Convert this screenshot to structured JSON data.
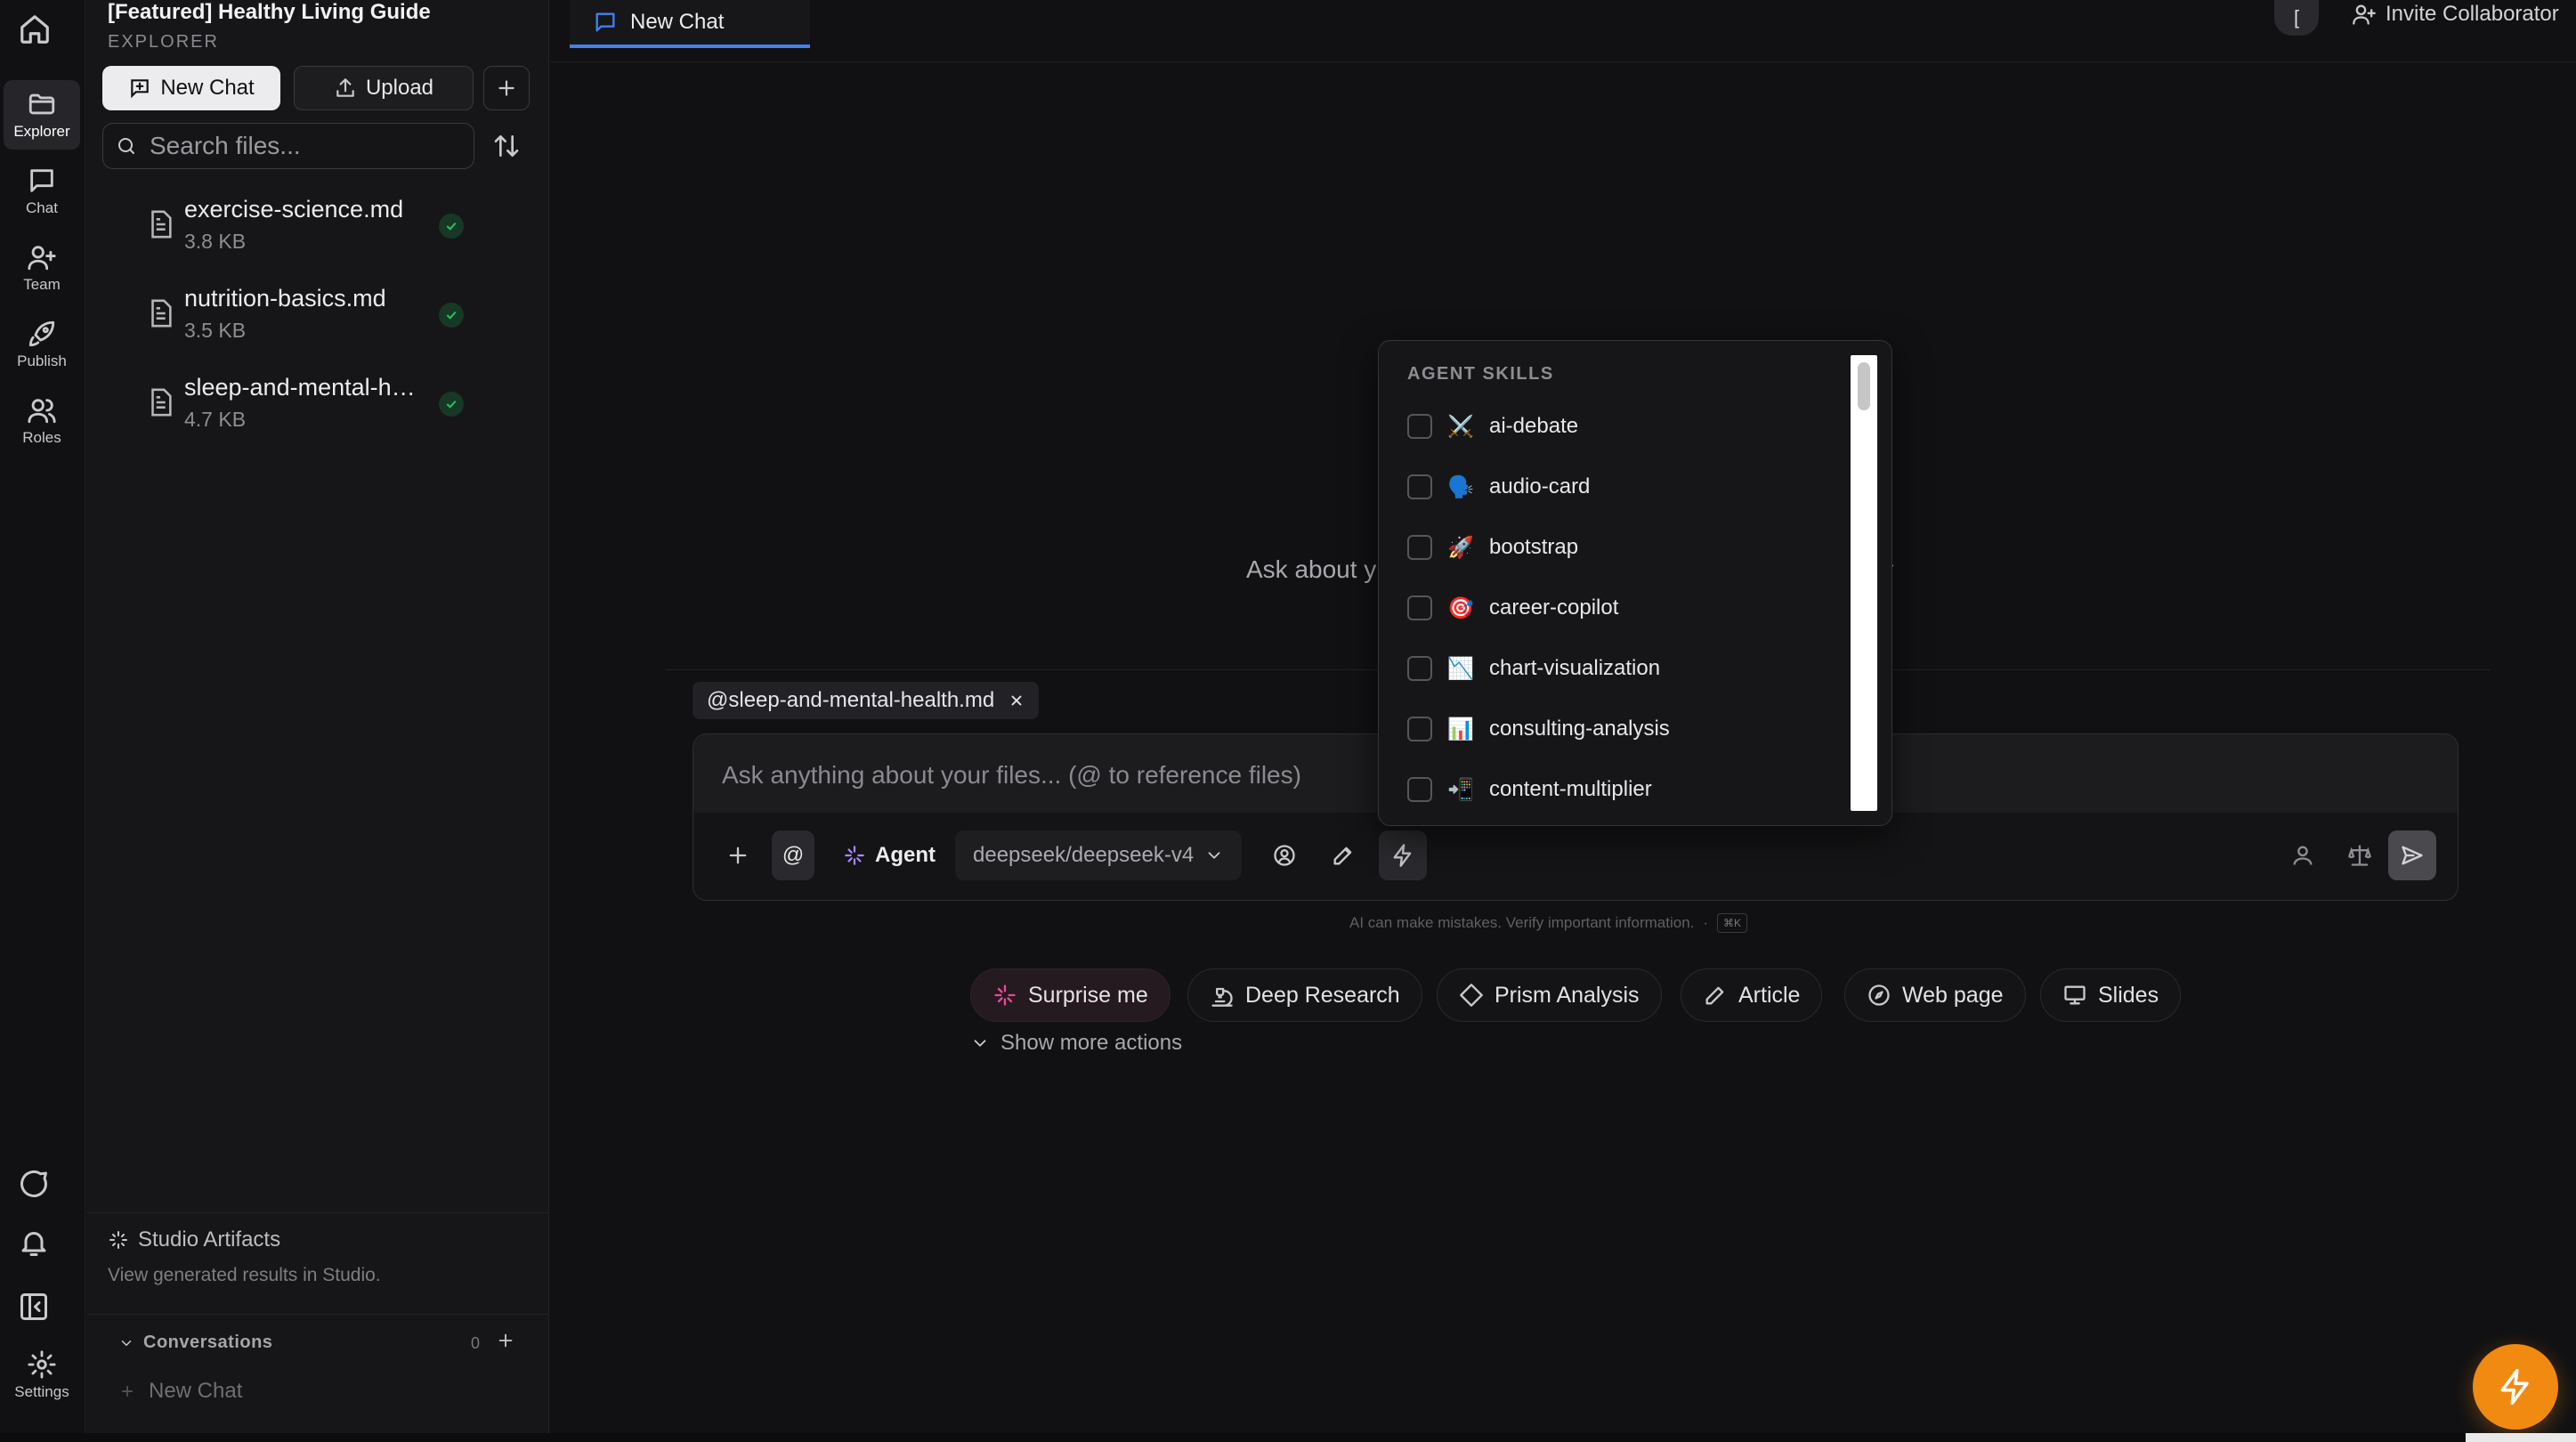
{
  "rail": {
    "items": [
      {
        "label": "Explorer"
      },
      {
        "label": "Chat"
      },
      {
        "label": "Team"
      },
      {
        "label": "Publish"
      },
      {
        "label": "Roles"
      }
    ],
    "settings_label": "Settings"
  },
  "explorer": {
    "project_title": "[Featured] Healthy Living Guide",
    "section_label": "EXPLORER",
    "new_chat_label": "New Chat",
    "upload_label": "Upload",
    "search_placeholder": "Search files...",
    "files": [
      {
        "name": "exercise-science.md",
        "size": "3.8 KB"
      },
      {
        "name": "nutrition-basics.md",
        "size": "3.5 KB"
      },
      {
        "name": "sleep-and-mental-health.md",
        "size": "4.7 KB"
      }
    ],
    "studio_title": "Studio Artifacts",
    "studio_sub": "View generated results in Studio.",
    "conversations_label": "Conversations",
    "conversations_count": "0",
    "conversation_item": "New Chat"
  },
  "topbar": {
    "tab_label": "New Chat",
    "avatar_initial": "[",
    "invite_label": "Invite Collaborator"
  },
  "main": {
    "empty_hint": "Ask about y",
    "empty_hint_tail": "r",
    "ref_chip": "@sleep-and-mental-health.md",
    "input_placeholder": "Ask anything about your files... (@ to reference files)",
    "at_label": "@",
    "agent_label": "Agent",
    "model_label": "deepseek/deepseek-v4",
    "disclaimer": "AI can make mistakes. Verify important information.",
    "disclaimer_kbd": "⌘K",
    "actions": [
      {
        "label": "Surprise me"
      },
      {
        "label": "Deep Research"
      },
      {
        "label": "Prism Analysis"
      },
      {
        "label": "Article"
      },
      {
        "label": "Web page"
      },
      {
        "label": "Slides"
      }
    ],
    "show_more": "Show more actions"
  },
  "skills": {
    "heading": "AGENT SKILLS",
    "items": [
      {
        "label": "ai-debate",
        "emoji": "⚔️"
      },
      {
        "label": "audio-card",
        "emoji": "🗣️"
      },
      {
        "label": "bootstrap",
        "emoji": "🚀"
      },
      {
        "label": "career-copilot",
        "emoji": "🎯"
      },
      {
        "label": "chart-visualization",
        "emoji": "📉"
      },
      {
        "label": "consulting-analysis",
        "emoji": "📊"
      },
      {
        "label": "content-multiplier",
        "emoji": "📲"
      }
    ]
  },
  "colors": {
    "accent_blue": "#3b82f6",
    "fab_orange": "#f08a10",
    "check_green": "#22c55e",
    "agent_purple": "#a78bfa",
    "surprise_pink": "#ec4899"
  }
}
